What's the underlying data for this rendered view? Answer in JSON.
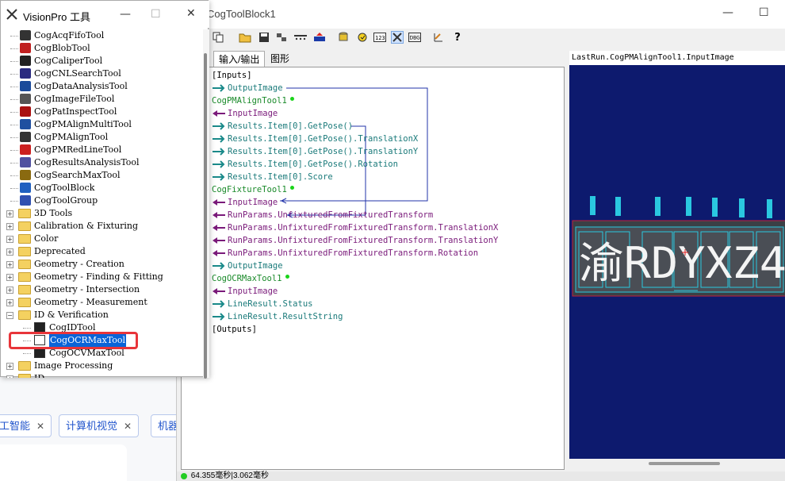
{
  "tool_window": {
    "title": "VisionPro 工具",
    "minimize": "—",
    "maximize": "☐",
    "close": "✕",
    "tools": [
      "CogAcqFifoTool",
      "CogBlobTool",
      "CogCaliperTool",
      "CogCNLSearchTool",
      "CogDataAnalysisTool",
      "CogImageFileTool",
      "CogPatInspectTool",
      "CogPMAlignMultiTool",
      "CogPMAlignTool",
      "CogPMRedLineTool",
      "CogResultsAnalysisTool",
      "CogSearchMaxTool",
      "CogToolBlock",
      "CogToolGroup"
    ],
    "folders": [
      {
        "label": "3D Tools",
        "expanded": false
      },
      {
        "label": "Calibration & Fixturing",
        "expanded": false
      },
      {
        "label": "Color",
        "expanded": false
      },
      {
        "label": "Deprecated",
        "expanded": false
      },
      {
        "label": "Geometry - Creation",
        "expanded": false
      },
      {
        "label": "Geometry - Finding & Fitting",
        "expanded": false
      },
      {
        "label": "Geometry - Intersection",
        "expanded": false
      },
      {
        "label": "Geometry - Measurement",
        "expanded": false
      },
      {
        "label": "ID & Verification",
        "expanded": true
      }
    ],
    "id_children": [
      "CogIDTool",
      "CogOCRMaxTool",
      "CogOCVMaxTool"
    ],
    "after_folders": [
      {
        "label": "Image Processing",
        "expanded": false
      },
      {
        "label": "ID...",
        "expanded": false
      }
    ],
    "selected": "CogOCRMaxTool"
  },
  "main_window": {
    "title": "CogToolBlock1",
    "minimize": "—",
    "maximize": "☐",
    "tabs": [
      "输入/输出",
      "图形"
    ],
    "tree": {
      "inputs": "[Inputs]",
      "outputs": "[Outputs]",
      "rows": [
        {
          "text": "OutputImage",
          "kind": "teal",
          "dir": "out"
        },
        {
          "text": "CogPMAlignTool1",
          "kind": "green",
          "dir": "tool"
        },
        {
          "text": "InputImage",
          "kind": "purple",
          "dir": "in"
        },
        {
          "text": "Results.Item[0].GetPose()",
          "kind": "teal",
          "dir": "out"
        },
        {
          "text": "Results.Item[0].GetPose().TranslationX",
          "kind": "teal",
          "dir": "out"
        },
        {
          "text": "Results.Item[0].GetPose().TranslationY",
          "kind": "teal",
          "dir": "out"
        },
        {
          "text": "Results.Item[0].GetPose().Rotation",
          "kind": "teal",
          "dir": "out"
        },
        {
          "text": "Results.Item[0].Score",
          "kind": "teal",
          "dir": "out"
        },
        {
          "text": "CogFixtureTool1",
          "kind": "green",
          "dir": "tool"
        },
        {
          "text": "InputImage",
          "kind": "purple",
          "dir": "in"
        },
        {
          "text": "RunParams.UnfixturedFromFixturedTransform",
          "kind": "purple",
          "dir": "in"
        },
        {
          "text": "RunParams.UnfixturedFromFixturedTransform.TranslationX",
          "kind": "purple",
          "dir": "in"
        },
        {
          "text": "RunParams.UnfixturedFromFixturedTransform.TranslationY",
          "kind": "purple",
          "dir": "in"
        },
        {
          "text": "RunParams.UnfixturedFromFixturedTransform.Rotation",
          "kind": "purple",
          "dir": "in"
        },
        {
          "text": "OutputImage",
          "kind": "teal",
          "dir": "out"
        },
        {
          "text": "CogOCRMaxTool1",
          "kind": "green",
          "dir": "tool"
        },
        {
          "text": "InputImage",
          "kind": "purple",
          "dir": "in"
        },
        {
          "text": "LineResult.Status",
          "kind": "teal",
          "dir": "out"
        },
        {
          "text": "LineResult.ResultString",
          "kind": "teal",
          "dir": "out"
        }
      ]
    },
    "image_header": "LastRun.CogPMAlignTool1.InputImage",
    "plate_chars": "渝RDYXZ4",
    "status_text": "64.355毫秒|3.062毫秒"
  },
  "background": {
    "tags": [
      "工智能",
      "计算机视觉",
      "机器"
    ],
    "tag_close": "✕"
  },
  "colors": {
    "selection": "#0a64d8",
    "highlight": "#e8353a",
    "image_bg": "#0d1a6e",
    "link": "#2233aa"
  }
}
